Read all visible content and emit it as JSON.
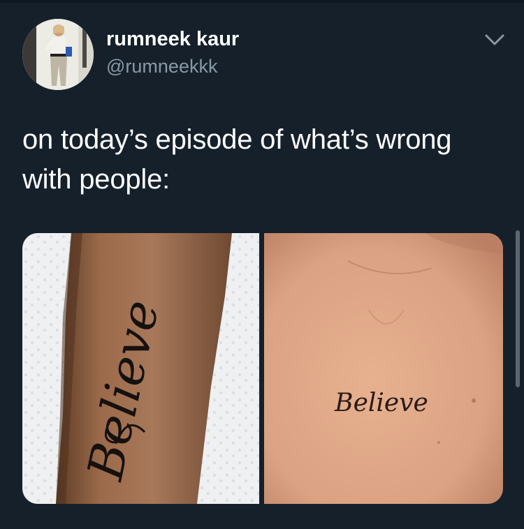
{
  "tweet": {
    "display_name": "rumneek kaur",
    "handle": "@rumneekkk",
    "text_line1": "on today’s episode of what’s wrong",
    "text_line2": "with people:",
    "media": [
      {
        "tattoo_text": "Believe"
      },
      {
        "tattoo_text": "Believe"
      }
    ]
  },
  "icons": {
    "more": "chevron-down-icon"
  },
  "colors": {
    "background": "#15202b",
    "text_primary": "#ffffff",
    "text_secondary": "#8899a6"
  }
}
